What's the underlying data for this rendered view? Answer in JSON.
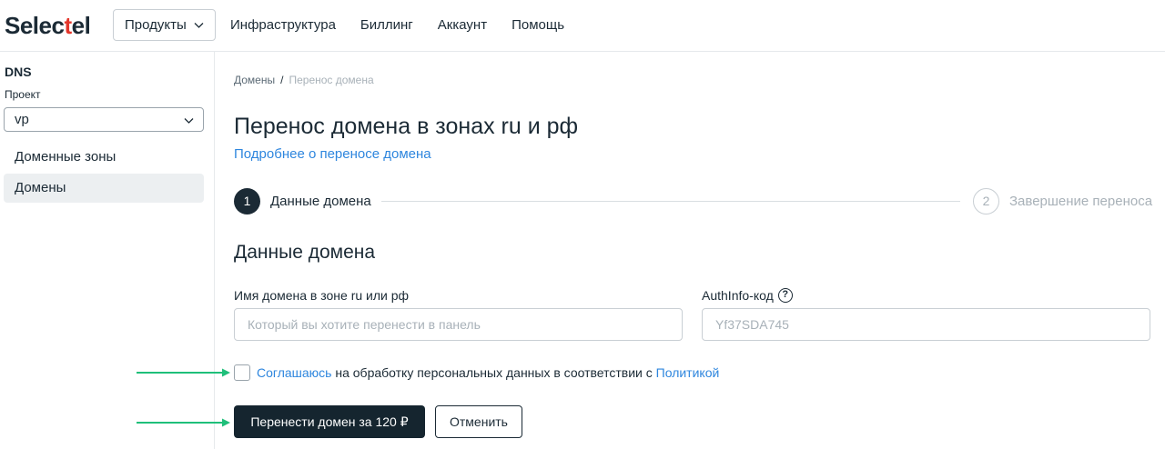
{
  "brand": {
    "logo_left": "Selec",
    "logo_red": "t",
    "logo_right": "el"
  },
  "topnav": {
    "products": "Продукты",
    "items": [
      "Инфраструктура",
      "Биллинг",
      "Аккаунт",
      "Помощь"
    ]
  },
  "sidebar": {
    "title": "DNS",
    "project_label": "Проект",
    "project_value": "vp",
    "items": [
      {
        "label": "Доменные зоны"
      },
      {
        "label": "Домены"
      }
    ]
  },
  "breadcrumb": {
    "root": "Домены",
    "sep": "/",
    "current": "Перенос домена"
  },
  "page": {
    "title": "Перенос домена в зонах ru и рф",
    "more_link": "Подробнее о переносе домена"
  },
  "steps": [
    {
      "num": "1",
      "label": "Данные домена"
    },
    {
      "num": "2",
      "label": "Завершение переноса"
    }
  ],
  "form": {
    "section_title": "Данные домена",
    "domain_label": "Имя домена в зоне ru или рф",
    "domain_placeholder": "Который вы хотите перенести в панель",
    "auth_label": "AuthInfo-код",
    "auth_placeholder": "Yf37SDA745",
    "help_glyph": "?",
    "consent_link1": "Соглашаюсь",
    "consent_text": " на обработку персональных данных в соответствии с ",
    "consent_link2": "Политикой",
    "submit_label": "Перенести домен за  120 ₽",
    "cancel_label": "Отменить"
  },
  "colors": {
    "accent_link": "#2e86de",
    "primary_button": "#15252f",
    "logo_red": "#e4362b",
    "annotation_arrow": "#1fbf7a"
  },
  "icons": [
    "chevron-down-icon",
    "help-circle-icon",
    "arrow-right-icon"
  ]
}
